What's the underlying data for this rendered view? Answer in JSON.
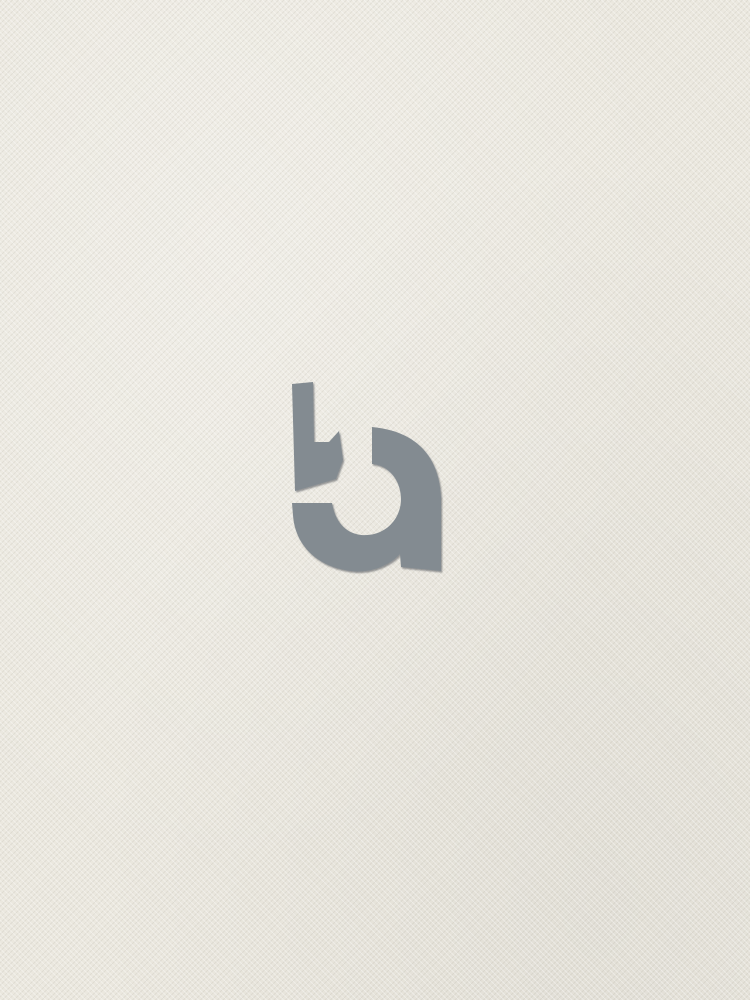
{
  "scene": {
    "description_color": "#ebe8df"
  },
  "logo": {
    "icon": "ba-monogram-icon",
    "color": "#838b91",
    "shadow_color": "#4c5054"
  }
}
